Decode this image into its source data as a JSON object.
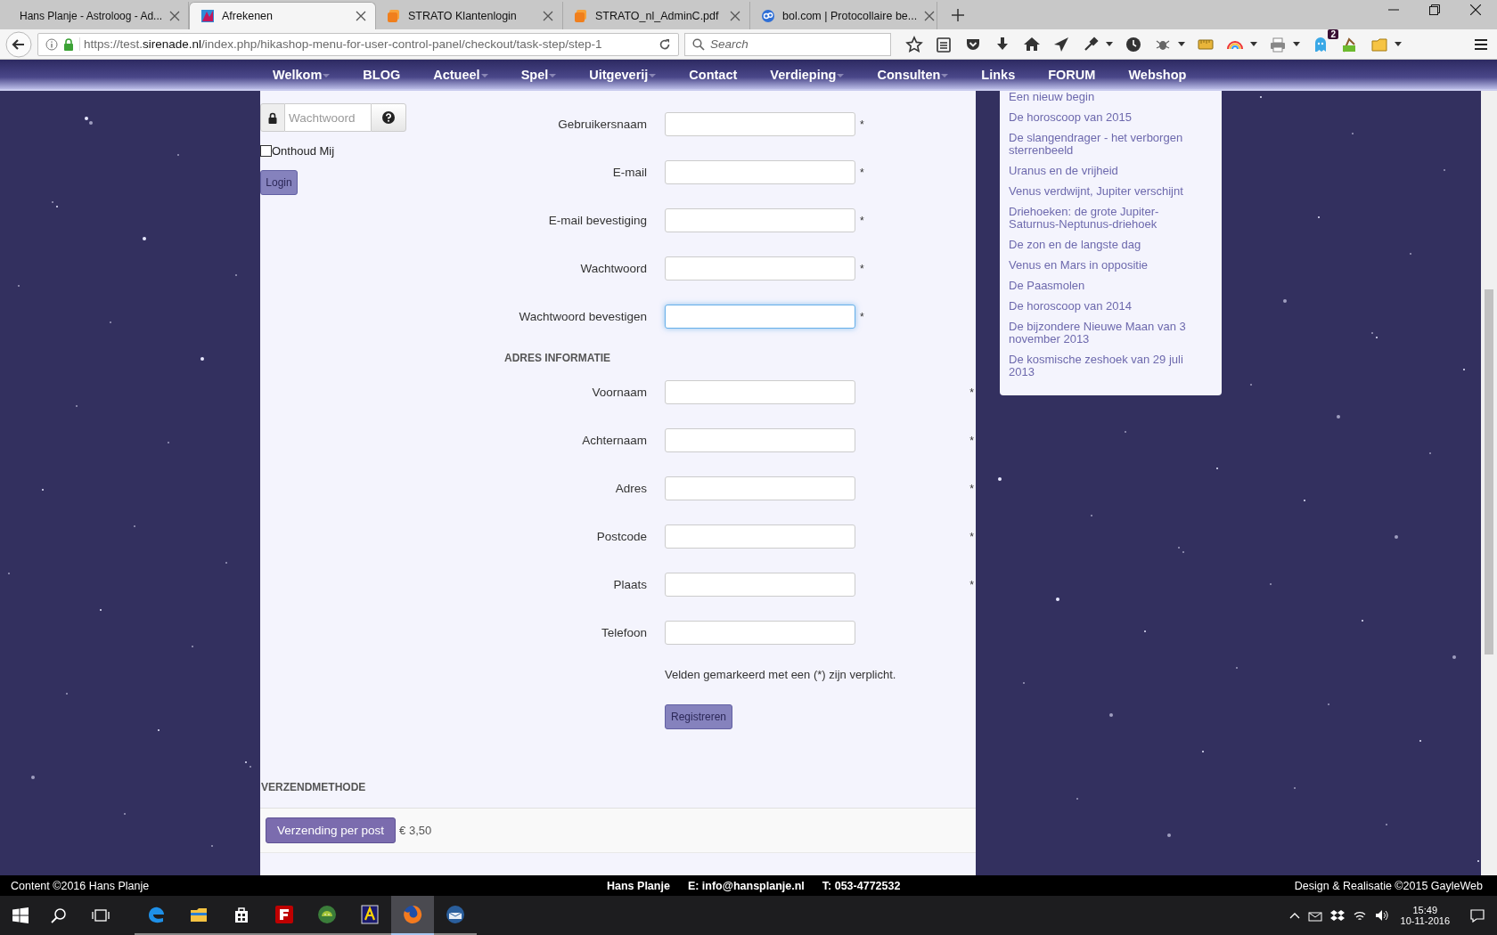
{
  "browser": {
    "tabs": [
      {
        "title": "Hans Planje - Astroloog - Ad...",
        "selected": false
      },
      {
        "title": "Afrekenen",
        "selected": true
      },
      {
        "title": "STRATO Klantenlogin",
        "selected": false
      },
      {
        "title": "STRATO_nl_AdminC.pdf",
        "selected": false
      },
      {
        "title": "bol.com | Protocollaire be...",
        "selected": false
      }
    ],
    "url": {
      "scheme": "https://test.",
      "domain": "sirenade.nl",
      "path": "/index.php/hikashop-menu-for-user-control-panel/checkout/task-step/step-1"
    },
    "search_placeholder": "Search",
    "badge": "2"
  },
  "site_nav": [
    {
      "label": "Welkom",
      "has_submenu": true
    },
    {
      "label": "BLOG",
      "has_submenu": false
    },
    {
      "label": "Actueel",
      "has_submenu": true
    },
    {
      "label": "Spel",
      "has_submenu": true
    },
    {
      "label": "Uitgeverij",
      "has_submenu": true
    },
    {
      "label": "Contact",
      "has_submenu": false
    },
    {
      "label": "Verdieping",
      "has_submenu": true
    },
    {
      "label": "Consulten",
      "has_submenu": true
    },
    {
      "label": "Links",
      "has_submenu": false
    },
    {
      "label": "FORUM",
      "has_submenu": false
    },
    {
      "label": "Webshop",
      "has_submenu": false
    }
  ],
  "login": {
    "password_placeholder": "Wachtwoord",
    "remember_label": "Onthoud Mij",
    "remember_checked": false,
    "button": "Login",
    "button_disabled": true
  },
  "sections": [
    {
      "kind": "account",
      "fields": [
        {
          "label": "Gebruikersnaam",
          "mark": "*",
          "focused": false
        },
        {
          "label": "E-mail",
          "mark": "*",
          "focused": false
        },
        {
          "label": "E-mail bevestiging",
          "mark": "*",
          "focused": false
        },
        {
          "label": "Wachtwoord",
          "mark": "*",
          "focused": false
        },
        {
          "label": "Wachtwoord bevestigen",
          "mark": "*",
          "focused": true
        }
      ]
    },
    {
      "kind": "address",
      "heading": "ADRES INFORMATIE",
      "fields": [
        {
          "label": "Voornaam",
          "mark": "*",
          "focused": false
        },
        {
          "label": "Achternaam",
          "mark": "*",
          "focused": false
        },
        {
          "label": "Adres",
          "mark": "*",
          "focused": false
        },
        {
          "label": "Postcode",
          "mark": "*",
          "focused": false
        },
        {
          "label": "Plaats",
          "mark": "*",
          "focused": false
        },
        {
          "label": "Telefoon",
          "focused": false
        }
      ]
    }
  ],
  "required_note": "Velden gemarkeerd met een (*) zijn verplicht.",
  "register_button": {
    "label": "Registreren",
    "disabled": true
  },
  "shipping": {
    "heading": "VERZENDMETHODE",
    "method": "Verzending per post",
    "price": "€ 3,50"
  },
  "sidebar": {
    "items": [
      "Een nieuw begin",
      "De horoscoop van 2015",
      "De slangendrager - het verborgen sterrenbeeld",
      "Uranus en de vrijheid",
      "Venus verdwijnt, Jupiter verschijnt",
      "Driehoeken: de grote Jupiter-Saturnus-Neptunus-driehoek",
      "De zon en de langste dag",
      "Venus en Mars in oppositie",
      "De Paasmolen",
      "De horoscoop van 2014",
      "De bijzondere Nieuwe Maan van 3 november 2013",
      "De kosmische zeshoek van 29 juli 2013"
    ]
  },
  "footer": {
    "left": "Content ©2016 Hans Planje",
    "name": "Hans Planje",
    "email": "E: info@hansplanje.nl",
    "phone": "T: 053-4772532",
    "right": "Design & Realisatie ©2015 GayleWeb"
  },
  "taskbar": {
    "apps": [
      {
        "selected": false
      },
      {
        "selected": false
      },
      {
        "selected": false
      },
      {
        "selected": false
      },
      {
        "selected": false
      },
      {
        "selected": false
      },
      {
        "selected": true
      },
      {
        "selected": false
      }
    ],
    "time": "15:49",
    "date": "10-11-2016"
  }
}
